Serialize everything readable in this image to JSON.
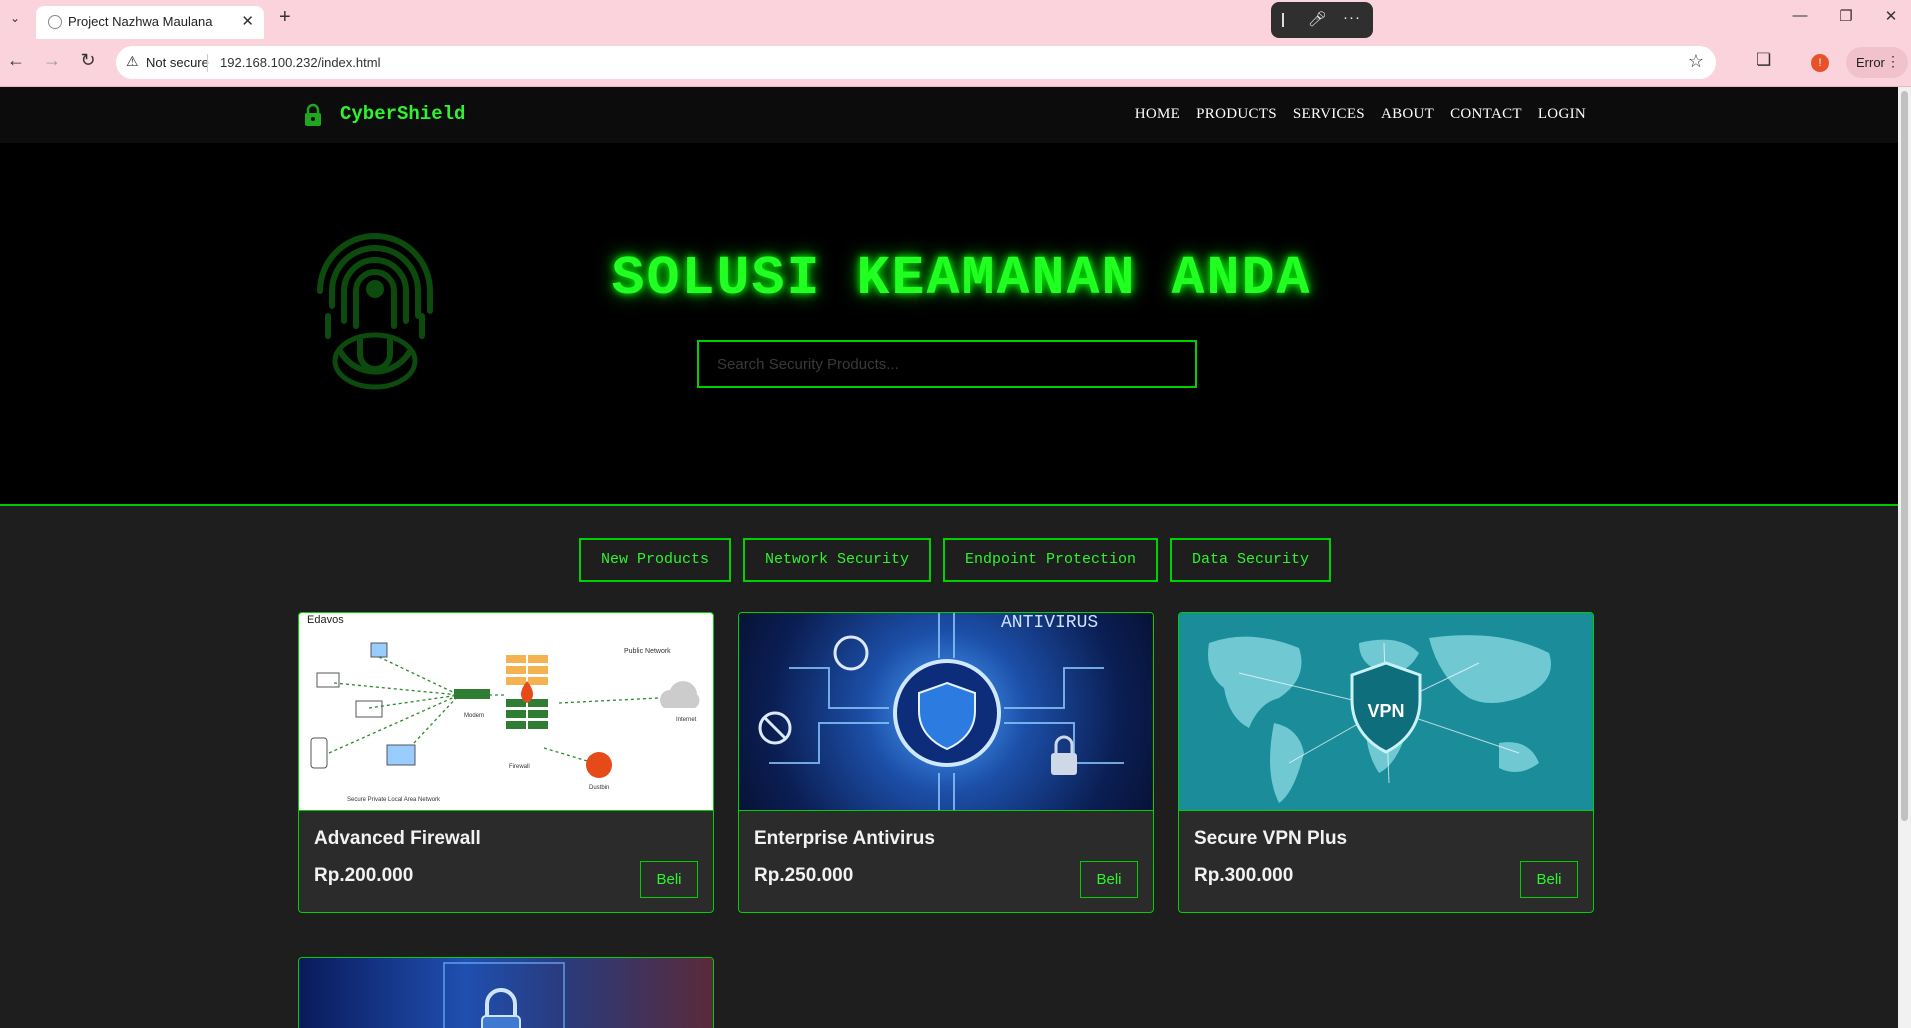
{
  "browser": {
    "tab_title": "Project Nazhwa Maulana",
    "new_tab": "+",
    "security_label": "Not secure",
    "url": "192.168.100.232/index.html",
    "profile_initial": "!",
    "error_label": "Error"
  },
  "site": {
    "brand": "CyberShield",
    "nav": [
      "HOME",
      "PRODUCTS",
      "SERVICES",
      "ABOUT",
      "CONTACT",
      "LOGIN"
    ],
    "hero_title": "SOLUSI KEAMANAN ANDA",
    "search_placeholder": "Search Security Products...",
    "filters": [
      "New Products",
      "Network Security",
      "Endpoint Protection",
      "Data Security"
    ],
    "products": [
      {
        "name": "Advanced Firewall",
        "price": "Rp.200.000",
        "buy": "Beli",
        "image": "firewall-diagram"
      },
      {
        "name": "Enterprise Antivirus",
        "price": "Rp.250.000",
        "buy": "Beli",
        "image": "antivirus-shield"
      },
      {
        "name": "Secure VPN Plus",
        "price": "Rp.300.000",
        "buy": "Beli",
        "image": "vpn-world-map"
      }
    ],
    "firewall_labels": [
      "Edavos",
      "Public Network",
      "Modem",
      "Internet",
      "Firewall",
      "Dustbin",
      "Secure Private Local Area Network"
    ],
    "vpn_label": "VPN",
    "antivirus_label": "ANTIVIRUS",
    "colors": {
      "accent": "#00ff00",
      "background": "#1e1e1e",
      "hero_bg": "#000000",
      "tabbar": "#fbd3dc"
    }
  }
}
